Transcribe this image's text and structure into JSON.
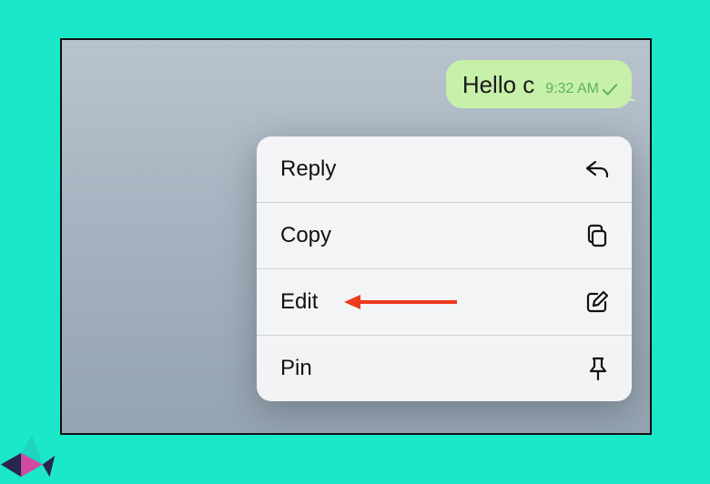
{
  "colors": {
    "page_bg": "#1ae8c9",
    "bubble_bg": "#c7f0a8",
    "bubble_meta": "#5fb25a",
    "menu_bg": "#f6f6f8",
    "annotation": "#ee3a1f"
  },
  "message": {
    "text": "Hello c",
    "timestamp": "9:32 AM",
    "status_icon": "checkmark-single"
  },
  "context_menu": {
    "items": [
      {
        "label": "Reply",
        "icon": "reply-icon"
      },
      {
        "label": "Copy",
        "icon": "copy-icon"
      },
      {
        "label": "Edit",
        "icon": "edit-icon",
        "highlighted": true
      },
      {
        "label": "Pin",
        "icon": "pin-icon"
      }
    ]
  },
  "annotation": {
    "type": "arrow",
    "target": "Edit"
  }
}
